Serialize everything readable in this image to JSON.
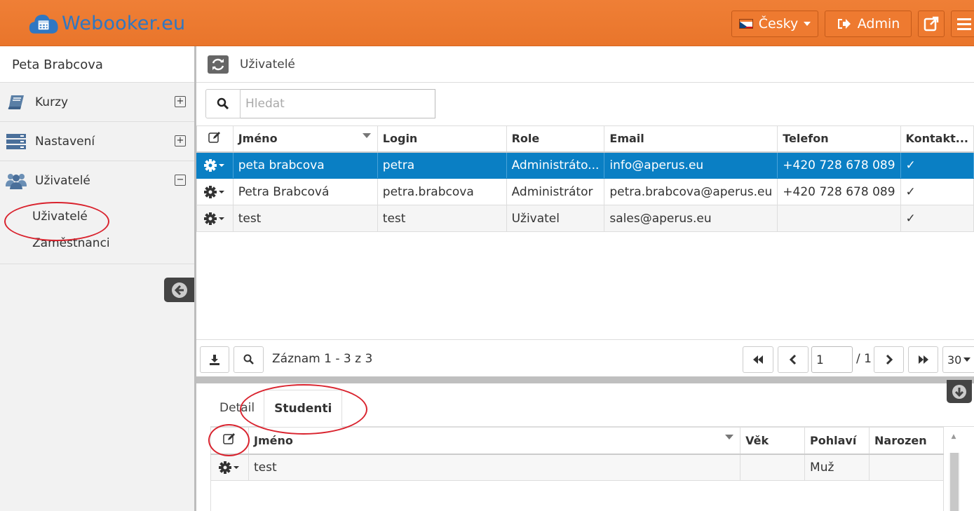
{
  "header": {
    "logo_text": "Webooker.eu",
    "language_label": "Česky",
    "admin_label": "Admin",
    "brand_color": "#ee7a30",
    "logo_color": "#2f77c2"
  },
  "sidebar": {
    "user_name": "Peta Brabcova",
    "items": [
      {
        "label": "Kurzy",
        "icon": "book-icon",
        "toggle": "+"
      },
      {
        "label": "Nastavení",
        "icon": "server-icon",
        "toggle": "+"
      },
      {
        "label": "Uživatelé",
        "icon": "users-icon",
        "toggle": "−"
      }
    ],
    "subitems": [
      "Uživatelé",
      "Zaměstnanci"
    ]
  },
  "main": {
    "title": "Uživatelé",
    "search_placeholder": "Hledat",
    "table": {
      "columns": [
        "Jméno",
        "Login",
        "Role",
        "Email",
        "Telefon",
        "Kontakt..."
      ],
      "rows": [
        {
          "name": "peta brabcova",
          "login": "petra",
          "role": "Administráto...",
          "email": "info@aperus.eu",
          "phone": "+420 728 678 089",
          "contact": "✓",
          "selected": true
        },
        {
          "name": "Petra Brabcová",
          "login": "petra.brabcova",
          "role": "Administrátor",
          "email": "petra.brabcova@aperus.eu",
          "phone": "+420 728 678 089",
          "contact": "✓",
          "selected": false
        },
        {
          "name": "test",
          "login": "test",
          "role": "Uživatel",
          "email": "sales@aperus.eu",
          "phone": "",
          "contact": "✓",
          "selected": false
        }
      ],
      "selected_color": "#0a7fc4"
    },
    "pager": {
      "record_text": "Záznam 1 - 3 z 3",
      "page": "1",
      "total_pages": "/ 1",
      "page_size": "30"
    }
  },
  "detail": {
    "tabs": [
      "Detail",
      "Studenti"
    ],
    "active_tab": "Studenti",
    "columns": [
      "Jméno",
      "Věk",
      "Pohlaví",
      "Narozen"
    ],
    "rows": [
      {
        "name": "test",
        "age": "",
        "gender": "Muž",
        "born": ""
      }
    ]
  },
  "annotation_color": "#d9232e"
}
